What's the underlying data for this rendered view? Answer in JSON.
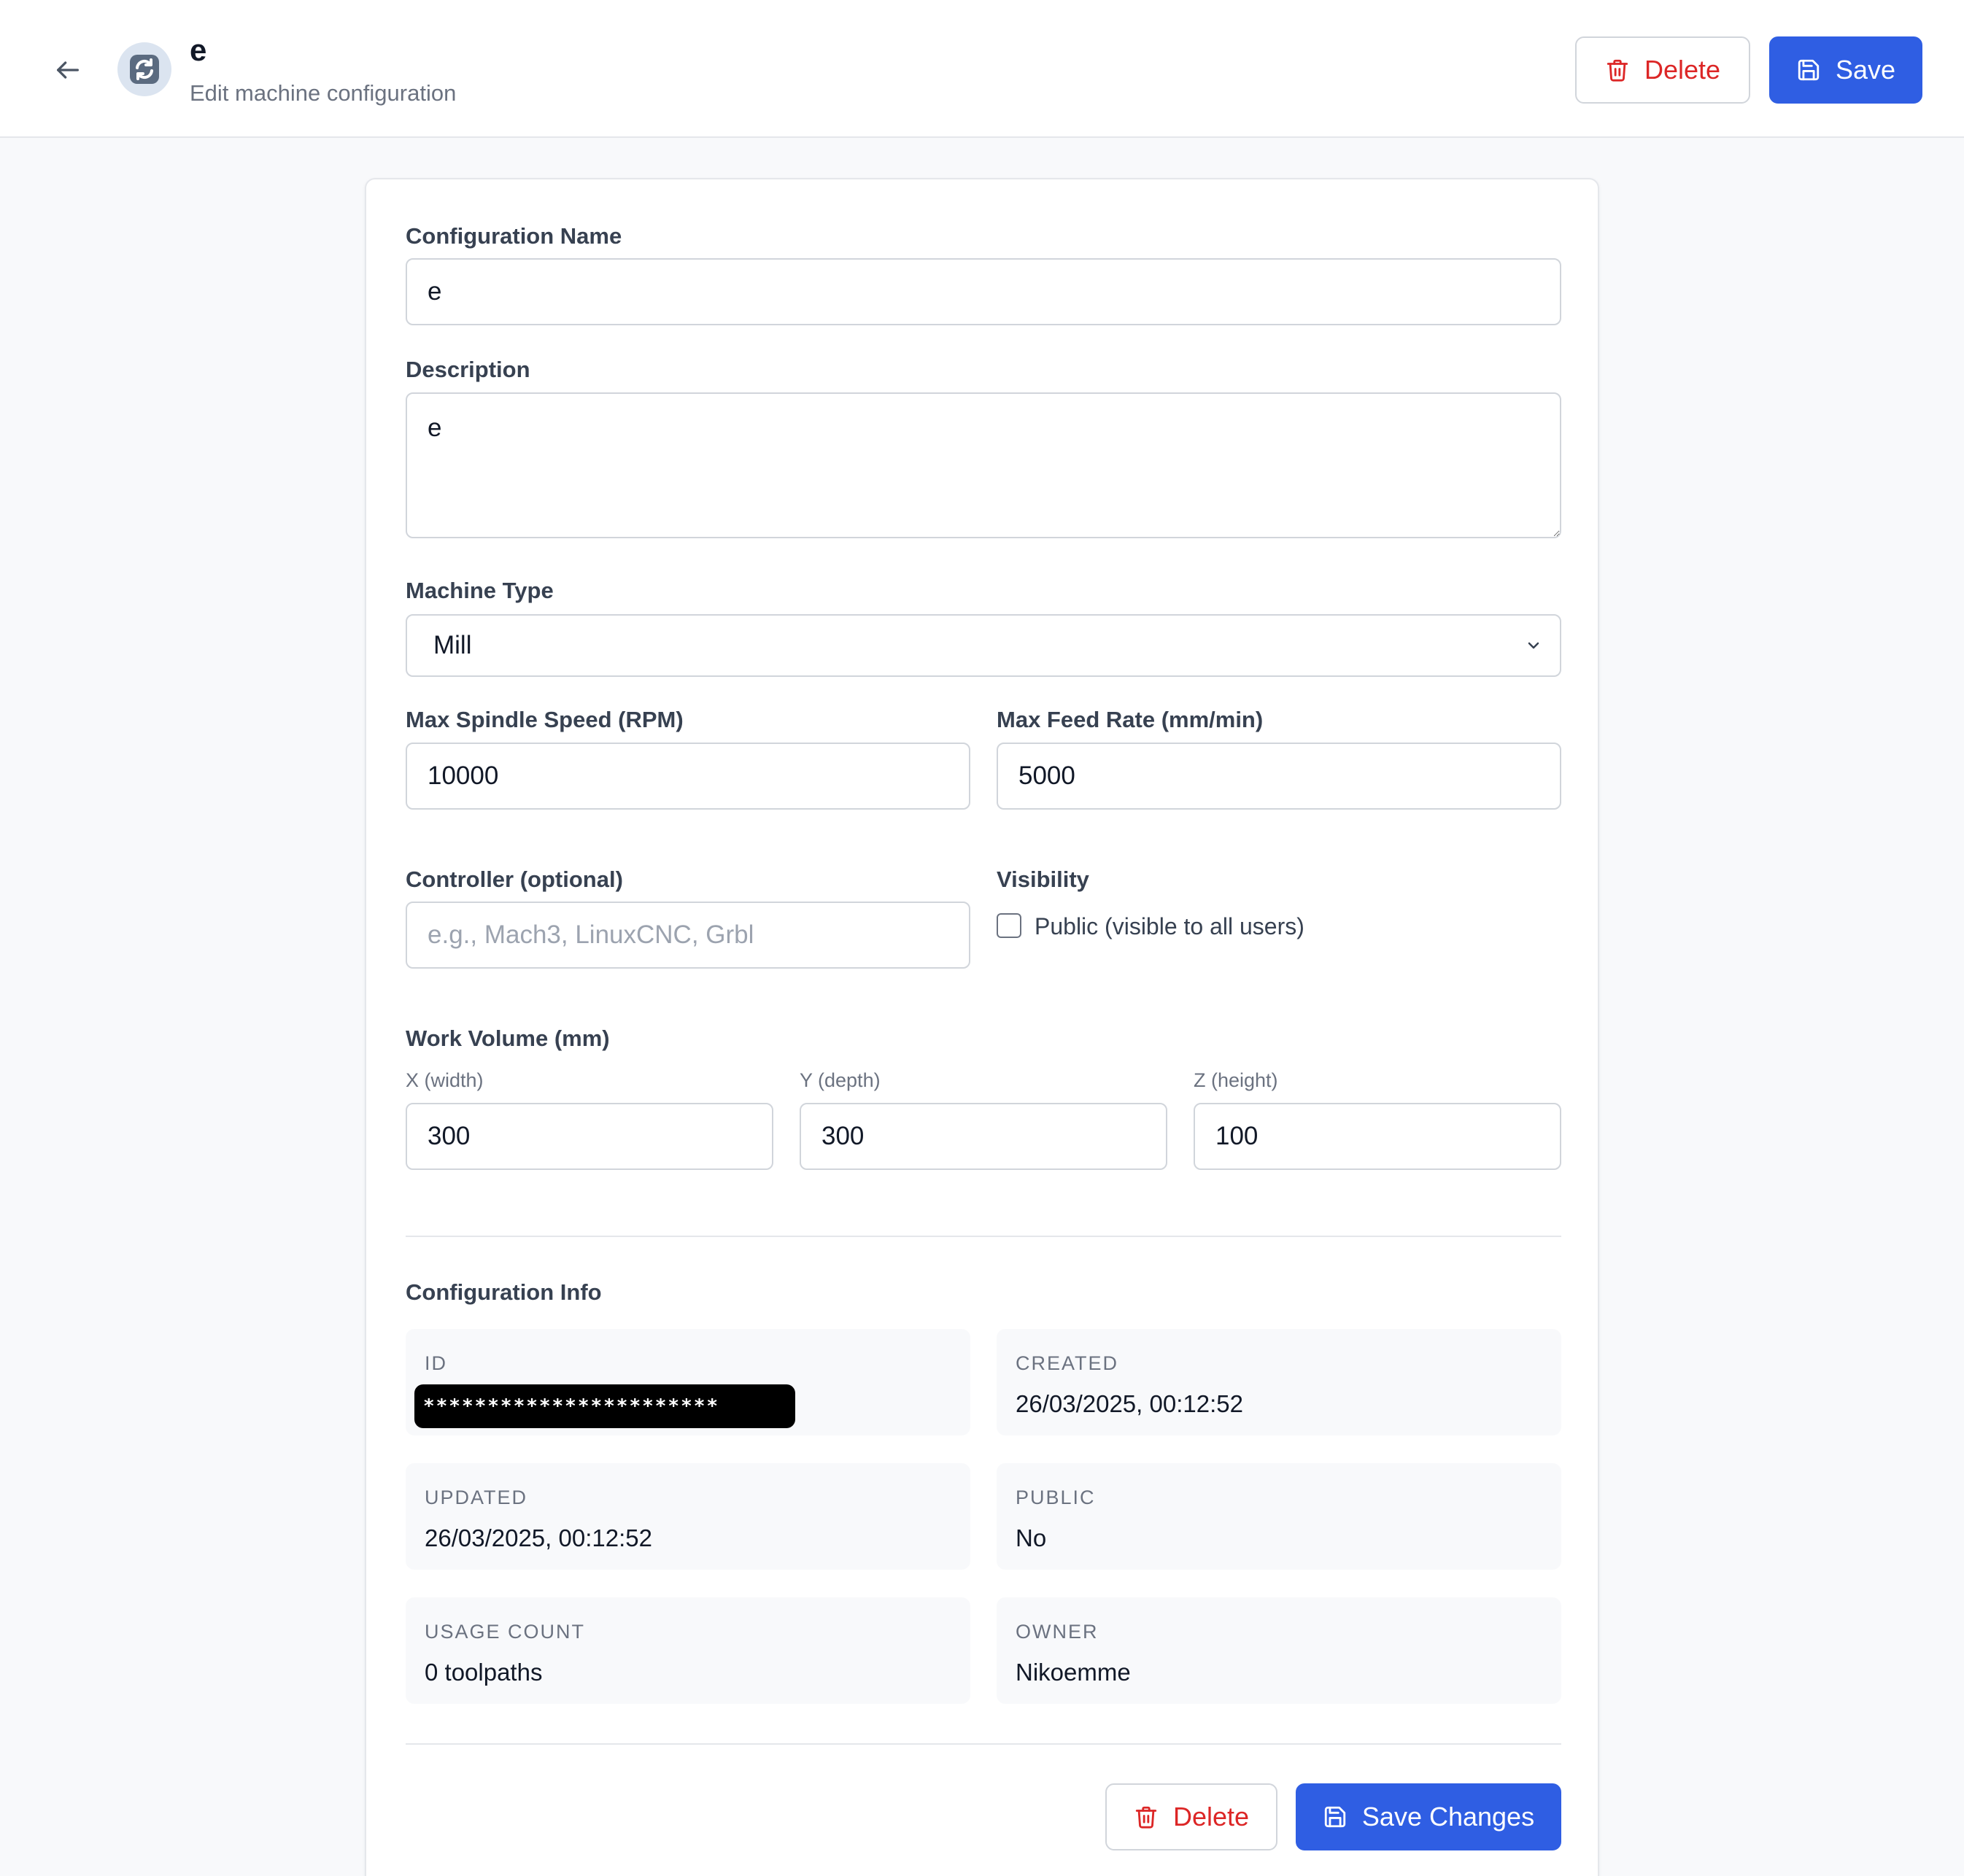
{
  "header": {
    "title": "e",
    "subtitle": "Edit machine configuration",
    "delete_label": "Delete",
    "save_label": "Save"
  },
  "form": {
    "config_name": {
      "label": "Configuration Name",
      "value": "e"
    },
    "description": {
      "label": "Description",
      "value": "e"
    },
    "machine_type": {
      "label": "Machine Type",
      "value": "Mill"
    },
    "max_spindle": {
      "label": "Max Spindle Speed (RPM)",
      "value": "10000"
    },
    "max_feed": {
      "label": "Max Feed Rate (mm/min)",
      "value": "5000"
    },
    "controller": {
      "label": "Controller (optional)",
      "value": "",
      "placeholder": "e.g., Mach3, LinuxCNC, Grbl"
    },
    "visibility": {
      "label": "Visibility",
      "checkbox_label": "Public (visible to all users)",
      "checked": false
    },
    "work_volume": {
      "label": "Work Volume (mm)",
      "x": {
        "label": "X (width)",
        "value": "300"
      },
      "y": {
        "label": "Y (depth)",
        "value": "300"
      },
      "z": {
        "label": "Z (height)",
        "value": "100"
      }
    }
  },
  "info": {
    "title": "Configuration Info",
    "id": {
      "key": "ID",
      "value": "***********************"
    },
    "created": {
      "key": "CREATED",
      "value": "26/03/2025, 00:12:52"
    },
    "updated": {
      "key": "UPDATED",
      "value": "26/03/2025, 00:12:52"
    },
    "public": {
      "key": "PUBLIC",
      "value": "No"
    },
    "usage": {
      "key": "USAGE COUNT",
      "value": "0 toolpaths"
    },
    "owner": {
      "key": "OWNER",
      "value": "Nikoemme"
    }
  },
  "footer": {
    "delete_label": "Delete",
    "save_label": "Save Changes"
  },
  "colors": {
    "primary": "#2f5ee3",
    "danger": "#dc2626",
    "background": "#f8f9fb"
  }
}
